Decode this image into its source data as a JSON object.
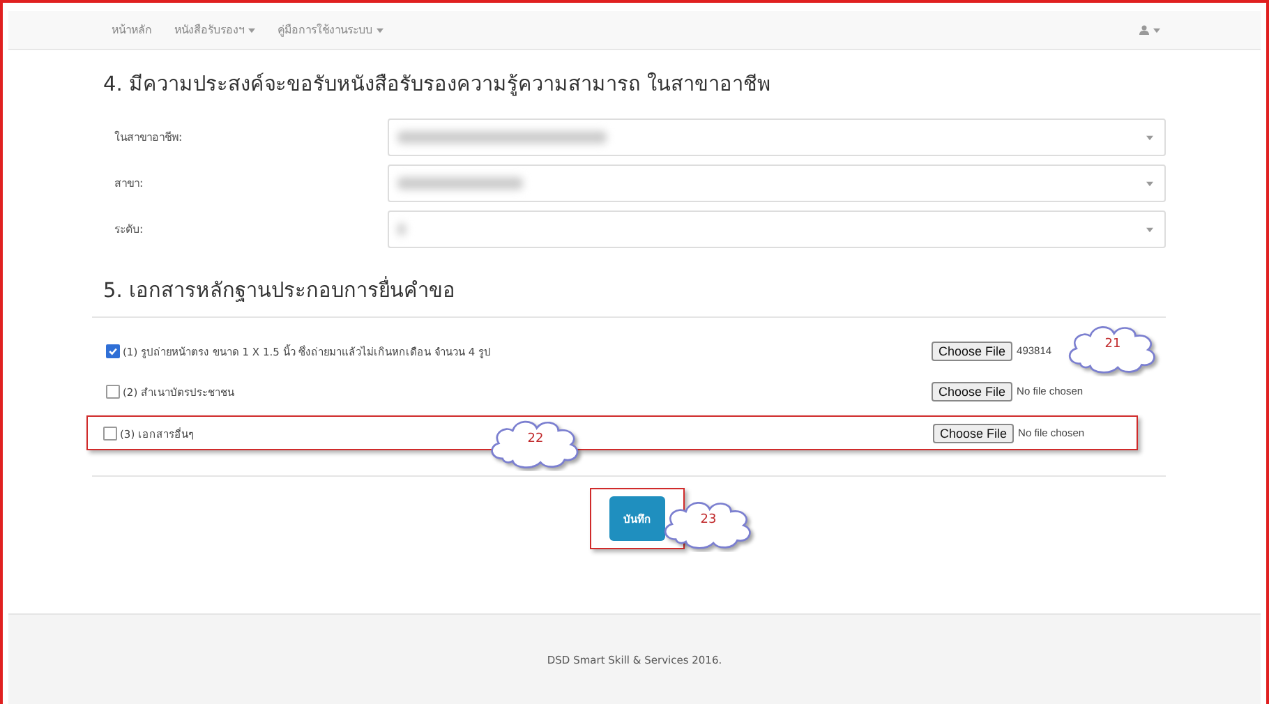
{
  "navbar": {
    "items": [
      {
        "label": "หน้าหลัก",
        "dropdown": false
      },
      {
        "label": "หนังสือรับรองฯ",
        "dropdown": true
      },
      {
        "label": "คู่มือการใช้งานระบบ",
        "dropdown": true
      }
    ],
    "user_menu": {
      "dropdown": true
    }
  },
  "section_4": {
    "title": "4. มีความประสงค์จะขอรับหนังสือรับรองความรู้ความสามารถ ในสาขาอาชีพ",
    "fields": [
      {
        "label": "ในสาขาอาชีพ:"
      },
      {
        "label": "สาขา:"
      },
      {
        "label": "ระดับ:"
      }
    ]
  },
  "section_5": {
    "title": "5. เอกสารหลักฐานประกอบการยื่นคำขอ",
    "documents": [
      {
        "label": "(1) รูปถ่ายหน้าตรง ขนาด 1 X 1.5 นิ้ว ซึ่งถ่ายมาแล้วไม่เกินหกเดือน จำนวน 4 รูป",
        "checked": true,
        "file_button": "Choose File",
        "file_status": "493814",
        "highlighted": false
      },
      {
        "label": "(2) สำเนาบัตรประชาชน",
        "checked": false,
        "file_button": "Choose File",
        "file_status": "No file chosen",
        "highlighted": false
      },
      {
        "label": "(3) เอกสารอื่นๆ",
        "checked": false,
        "file_button": "Choose File",
        "file_status": "No file chosen",
        "highlighted": true
      }
    ]
  },
  "submit": {
    "label": "บันทึก",
    "highlighted": true
  },
  "callouts": [
    {
      "label": "21"
    },
    {
      "label": "22"
    },
    {
      "label": "23"
    }
  ],
  "footer": {
    "text": "DSD Smart Skill & Services 2016."
  }
}
